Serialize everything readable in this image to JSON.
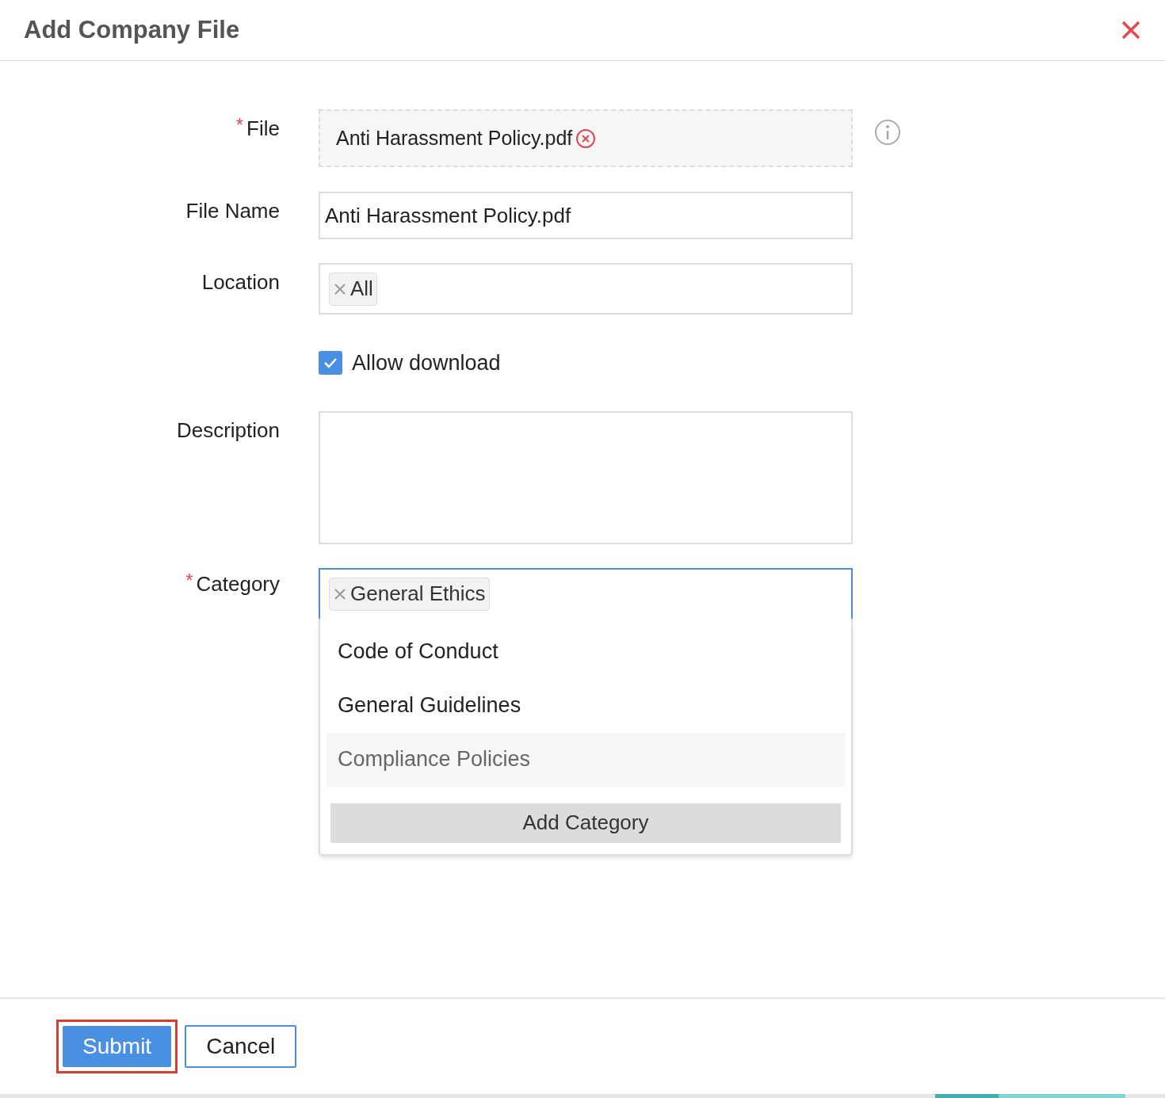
{
  "dialog": {
    "title": "Add Company File"
  },
  "file_field": {
    "label": "File",
    "required_mark": "*",
    "file_name": "Anti Harassment Policy.pdf"
  },
  "file_name_field": {
    "label": "File Name",
    "value": "Anti Harassment Policy.pdf"
  },
  "location_field": {
    "label": "Location",
    "tags": [
      "All"
    ]
  },
  "allow_download": {
    "label": "Allow download",
    "checked": true
  },
  "description_field": {
    "label": "Description"
  },
  "category_field": {
    "label": "Category",
    "required_mark": "*",
    "tags": [
      "General Ethics"
    ],
    "open": true,
    "options": [
      {
        "label": "Code of Conduct",
        "highlighted": false
      },
      {
        "label": "General Guidelines",
        "highlighted": false
      },
      {
        "label": "Compliance Policies",
        "highlighted": true
      }
    ],
    "add_button": "Add Category"
  },
  "buttons": [
    {
      "label": "Submit",
      "kind": "primary",
      "highlighted": true
    },
    {
      "label": "Cancel",
      "kind": "secondary",
      "highlighted": false
    }
  ]
}
